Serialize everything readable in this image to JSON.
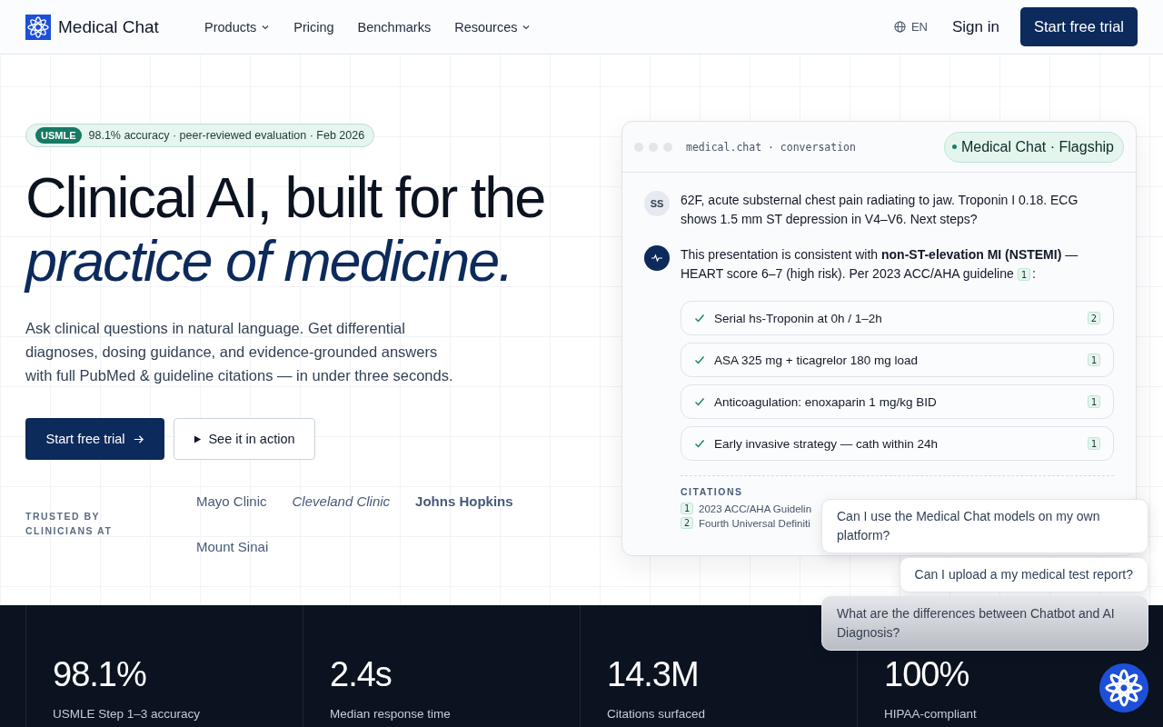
{
  "header": {
    "brand": "Medical Chat",
    "nav": [
      {
        "label": "Products",
        "has_dropdown": true
      },
      {
        "label": "Pricing",
        "has_dropdown": false
      },
      {
        "label": "Benchmarks",
        "has_dropdown": false
      },
      {
        "label": "Resources",
        "has_dropdown": true
      }
    ],
    "language": "EN",
    "sign_in": "Sign in",
    "cta": "Start free trial"
  },
  "hero": {
    "badge": {
      "tag": "USMLE",
      "text": "98.1% accuracy · peer-reviewed evaluation · Feb 2026"
    },
    "title_line_1": "Clinical AI, built for the",
    "title_line_2": "practice of medicine.",
    "subtitle": "Ask clinical questions in natural language. Get differential diagnoses, dosing guidance, and evidence-grounded answers with full PubMed & guideline citations — in under three seconds.",
    "primary_button": "Start free trial",
    "secondary_button": "See it in action",
    "trusted_label": "TRUSTED BY CLINICIANS AT",
    "institutions": [
      {
        "name": "Mayo Clinic",
        "kind": "regular"
      },
      {
        "name": "Cleveland Clinic",
        "kind": "italic"
      },
      {
        "name": "Johns Hopkins",
        "kind": "bold"
      },
      {
        "name": "Mount Sinai",
        "kind": "regular"
      }
    ]
  },
  "chat_card": {
    "address": "medical.chat · conversation",
    "model": "Medical Chat · Flagship",
    "user_message": {
      "avatar": "SS",
      "text": "62F, acute substernal chest pain radiating to jaw. Troponin I 0.18. ECG shows 1.5 mm ST depression in V4–V6. Next steps?"
    },
    "assistant_message": {
      "line_1": "This presentation is consistent with **non-ST-elevation MI (NSTEMI)** —",
      "line_2": "HEART score 6–7 (high risk). Per 2023 ACC/AHA guideline",
      "ref": "1",
      "after": ":"
    },
    "steps": [
      {
        "text": "Serial hs-Troponin at 0h / 1–2h",
        "ref": "2",
        "checked": true
      },
      {
        "text": "ASA 325 mg + ticagrelor 180 mg load",
        "ref": "1",
        "checked": true
      },
      {
        "text": "Anticoagulation: enoxaparin 1 mg/kg BID",
        "ref": "1",
        "checked": true
      },
      {
        "text": "Early invasive strategy — cath within 24h",
        "ref": "1",
        "checked": true
      }
    ],
    "citations_label": "CITATIONS",
    "citations": [
      {
        "num": "1",
        "text": "2023 ACC/AHA Guidelin"
      },
      {
        "num": "2",
        "text": "Fourth Universal Definiti"
      }
    ]
  },
  "suggestions": [
    {
      "text": "Can I use the Medical Chat models on my own platform?",
      "selected": false
    },
    {
      "text": "Can I upload a my medical test report?",
      "selected": false
    },
    {
      "text": "What are the differences between Chatbot and AI Diagnosis?",
      "selected": true
    }
  ],
  "stats": [
    {
      "value": "98.1%",
      "label": "USMLE Step 1–3 accuracy"
    },
    {
      "value": "2.4s",
      "label": "Median response time"
    },
    {
      "value": "14.3M",
      "label": "Citations surfaced"
    },
    {
      "value": "100%",
      "label": "HIPAA-compliant"
    }
  ]
}
